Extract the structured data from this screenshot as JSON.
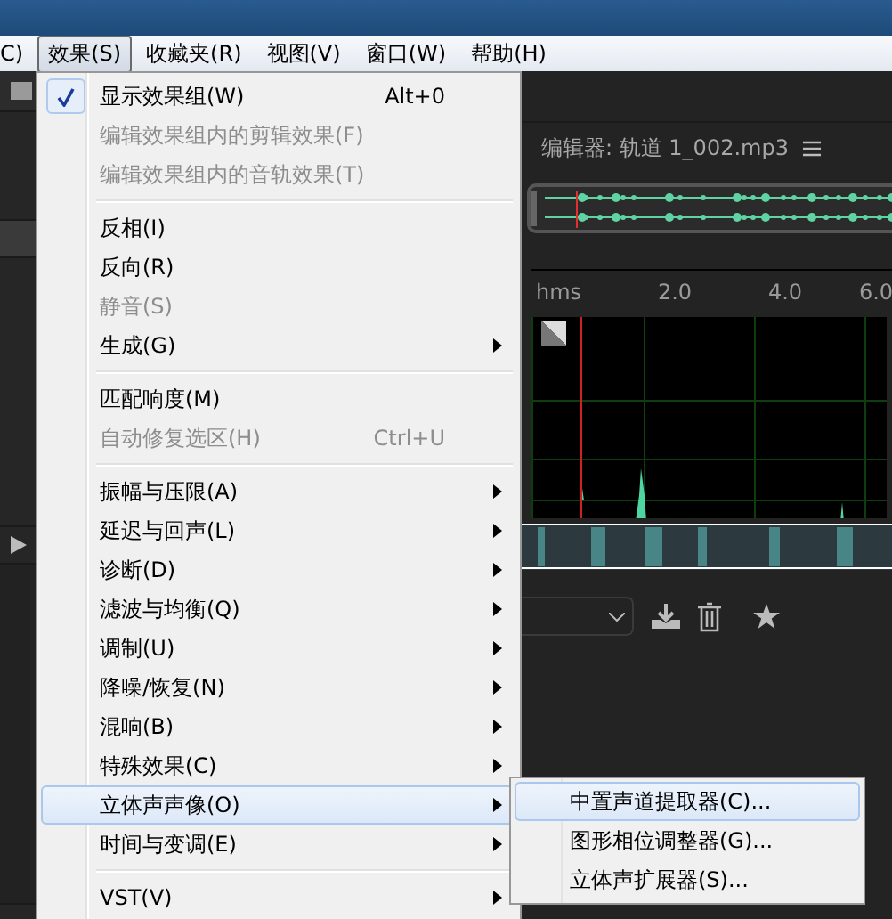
{
  "menu_bar": [
    {
      "label": "C)",
      "selected": false
    },
    {
      "label": "效果(S)",
      "selected": true
    },
    {
      "label": "收藏夹(R)",
      "selected": false
    },
    {
      "label": "视图(V)",
      "selected": false
    },
    {
      "label": "窗口(W)",
      "selected": false
    },
    {
      "label": "帮助(H)",
      "selected": false
    }
  ],
  "editor": {
    "title": "编辑器: 轨道 1_002.mp3",
    "ruler": [
      "hms",
      "2.0",
      "4.0",
      "6.0"
    ]
  },
  "effects_menu": {
    "sections": [
      [
        {
          "label": "显示效果组(W)",
          "shortcut": "Alt+0",
          "checked": true,
          "disabled": false,
          "submenu": false,
          "selected": false
        },
        {
          "label": "编辑效果组内的剪辑效果(F)",
          "checked": false,
          "disabled": true,
          "submenu": false,
          "selected": false
        },
        {
          "label": "编辑效果组内的音轨效果(T)",
          "checked": false,
          "disabled": true,
          "submenu": false,
          "selected": false
        }
      ],
      [
        {
          "label": "反相(I)",
          "checked": false,
          "disabled": false,
          "submenu": false,
          "selected": false
        },
        {
          "label": "反向(R)",
          "checked": false,
          "disabled": false,
          "submenu": false,
          "selected": false
        },
        {
          "label": "静音(S)",
          "checked": false,
          "disabled": true,
          "submenu": false,
          "selected": false
        },
        {
          "label": "生成(G)",
          "checked": false,
          "disabled": false,
          "submenu": true,
          "selected": false
        }
      ],
      [
        {
          "label": "匹配响度(M)",
          "checked": false,
          "disabled": false,
          "submenu": false,
          "selected": false
        },
        {
          "label": "自动修复选区(H)",
          "shortcut": "Ctrl+U",
          "checked": false,
          "disabled": true,
          "submenu": false,
          "selected": false
        }
      ],
      [
        {
          "label": "振幅与压限(A)",
          "checked": false,
          "disabled": false,
          "submenu": true,
          "selected": false
        },
        {
          "label": "延迟与回声(L)",
          "checked": false,
          "disabled": false,
          "submenu": true,
          "selected": false
        },
        {
          "label": "诊断(D)",
          "checked": false,
          "disabled": false,
          "submenu": true,
          "selected": false
        },
        {
          "label": "滤波与均衡(Q)",
          "checked": false,
          "disabled": false,
          "submenu": true,
          "selected": false
        },
        {
          "label": "调制(U)",
          "checked": false,
          "disabled": false,
          "submenu": true,
          "selected": false
        },
        {
          "label": "降噪/恢复(N)",
          "checked": false,
          "disabled": false,
          "submenu": true,
          "selected": false
        },
        {
          "label": "混响(B)",
          "checked": false,
          "disabled": false,
          "submenu": true,
          "selected": false
        },
        {
          "label": "特殊效果(C)",
          "checked": false,
          "disabled": false,
          "submenu": true,
          "selected": false
        },
        {
          "label": "立体声声像(O)",
          "checked": false,
          "disabled": false,
          "submenu": true,
          "selected": true
        },
        {
          "label": "时间与变调(E)",
          "checked": false,
          "disabled": false,
          "submenu": true,
          "selected": false
        }
      ],
      [
        {
          "label": "VST(V)",
          "checked": false,
          "disabled": false,
          "submenu": true,
          "selected": false
        }
      ]
    ]
  },
  "submenu": [
    {
      "label": "中置声道提取器(C)...",
      "selected": true
    },
    {
      "label": "图形相位调整器(G)...",
      "selected": false
    },
    {
      "label": "立体声扩展器(S)...",
      "selected": false
    }
  ]
}
